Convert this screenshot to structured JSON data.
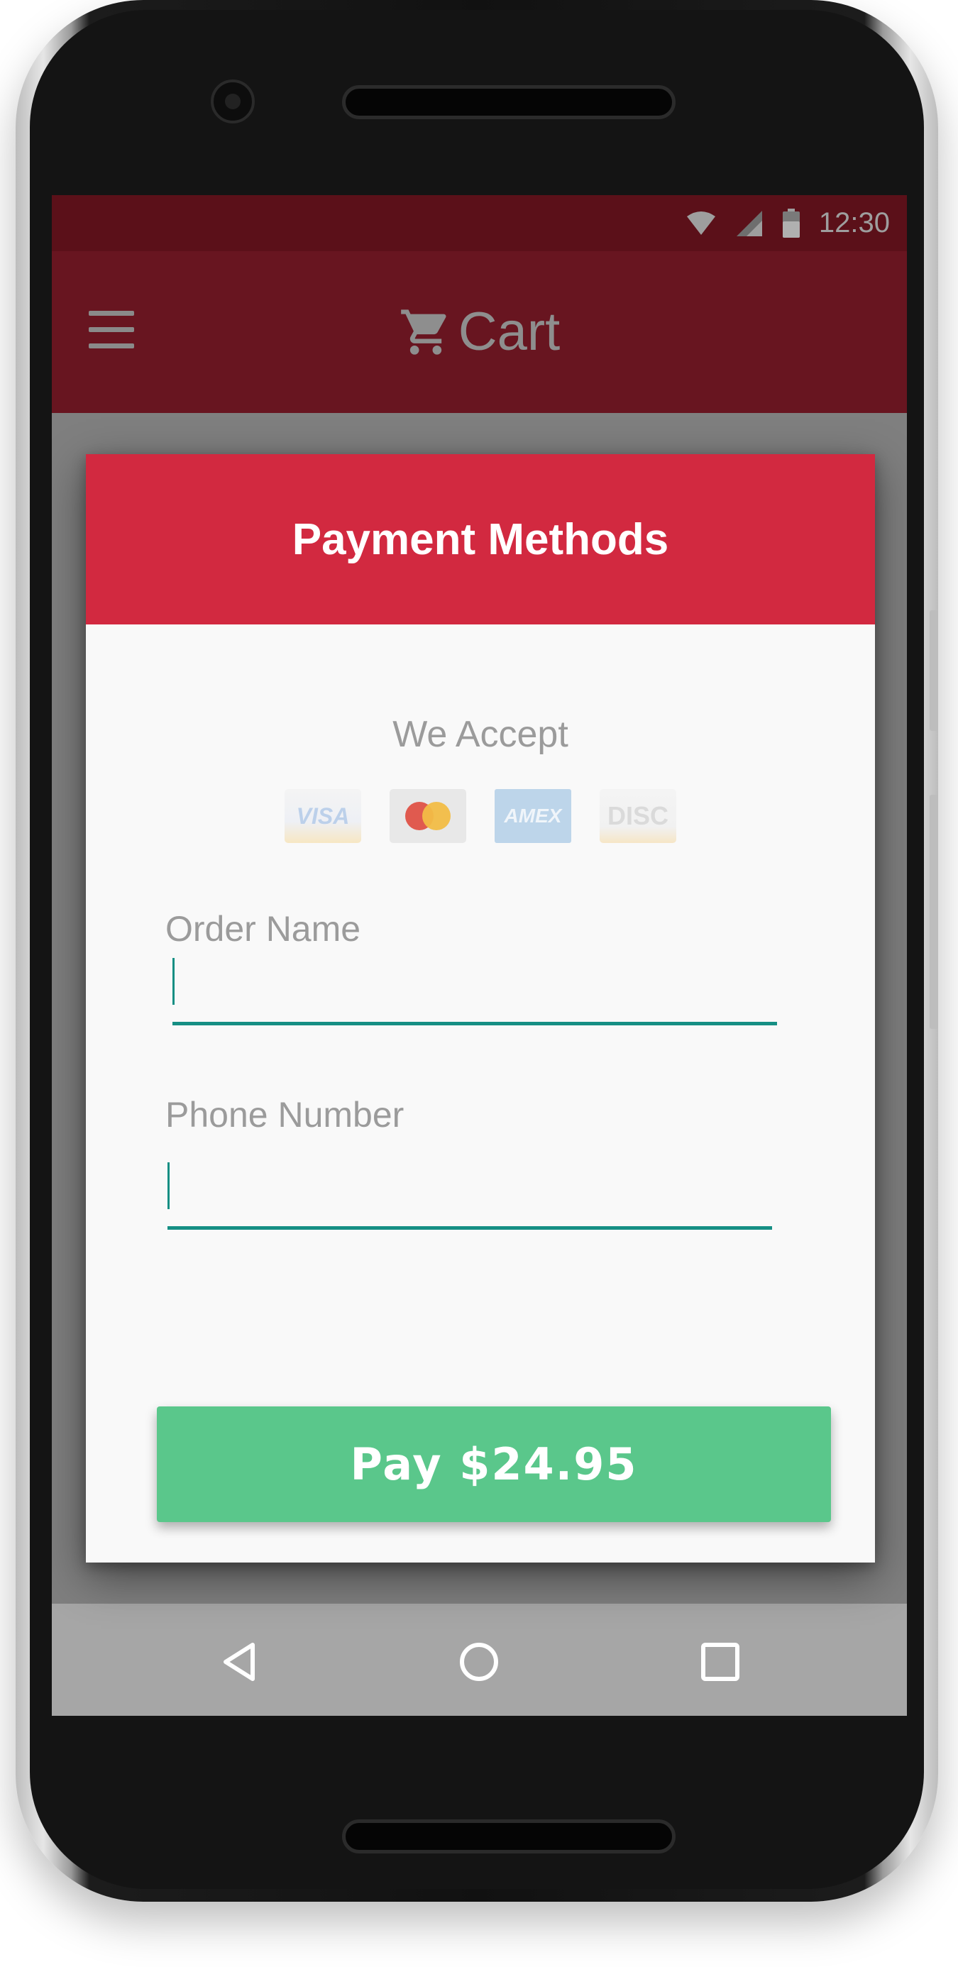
{
  "status_bar": {
    "time": "12:30"
  },
  "app_bar": {
    "title": "Cart",
    "menu_icon": "hamburger-menu-icon",
    "cart_icon": "shopping-cart-icon"
  },
  "dialog": {
    "title": "Payment Methods",
    "accept_label": "We Accept",
    "cards": [
      {
        "name": "visa-card-icon",
        "text": "VISA"
      },
      {
        "name": "mastercard-icon",
        "text": ""
      },
      {
        "name": "amex-card-icon",
        "text": "AMEX"
      },
      {
        "name": "discover-card-icon",
        "text": "DISC"
      }
    ],
    "fields": [
      {
        "label": "Order Name",
        "value": ""
      },
      {
        "label": "Phone Number",
        "value": ""
      }
    ],
    "pay_button": "Pay $24.95"
  },
  "nav_bar": {
    "back_icon": "back-triangle-icon",
    "home_icon": "home-circle-icon",
    "recents_icon": "recents-square-icon"
  },
  "colors": {
    "status_bar": "#5b1019",
    "app_bar": "#681520",
    "dialog_header": "#d22940",
    "pay_button": "#5ac78b",
    "field_underline": "#168f84"
  }
}
